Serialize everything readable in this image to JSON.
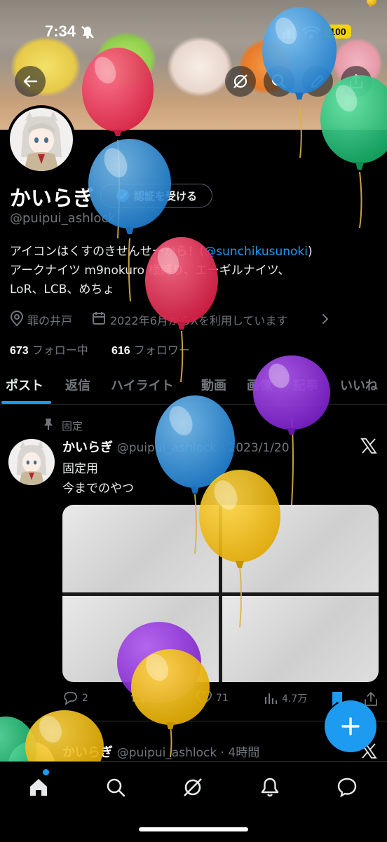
{
  "status_bar": {
    "time": "7:34",
    "battery": "100"
  },
  "profile": {
    "display_name": "かいらぎ",
    "verify_label": "認証を受ける",
    "handle": "@puipui_ashlock",
    "bio_line1_a": "アイコンはくすのきせんせーから！(",
    "bio_mention": "@sunchikusunoki",
    "bio_line1_b": ")",
    "bio_line2": "アークナイツ m9nokuro 様縛り、エーギルナイツ、",
    "bio_line3": "LoR、LCB、めちょ",
    "location": "罪の井戸",
    "joined": "2022年6月からXを利用しています",
    "following_count": "673",
    "following_label": "フォロー中",
    "followers_count": "616",
    "followers_label": "フォロワー"
  },
  "tabs": [
    "ポスト",
    "返信",
    "ハイライト",
    "動画",
    "画像",
    "記事",
    "いいね"
  ],
  "pinned_post": {
    "pinned_label": "固定",
    "author": "かいらぎ",
    "handle_date": "@puipui_ashlock · 2023/1/20",
    "text_line1": "固定用",
    "text_line2": "今までのやつ",
    "replies": "2",
    "likes": "71",
    "views": "4.7万"
  },
  "next_post": {
    "author": "かいらぎ",
    "handle_time": "@puipui_ashlock · 4時間"
  },
  "colors": {
    "accent": "#1d9bf0",
    "background": "#000000",
    "secondary_text": "#71767b"
  }
}
